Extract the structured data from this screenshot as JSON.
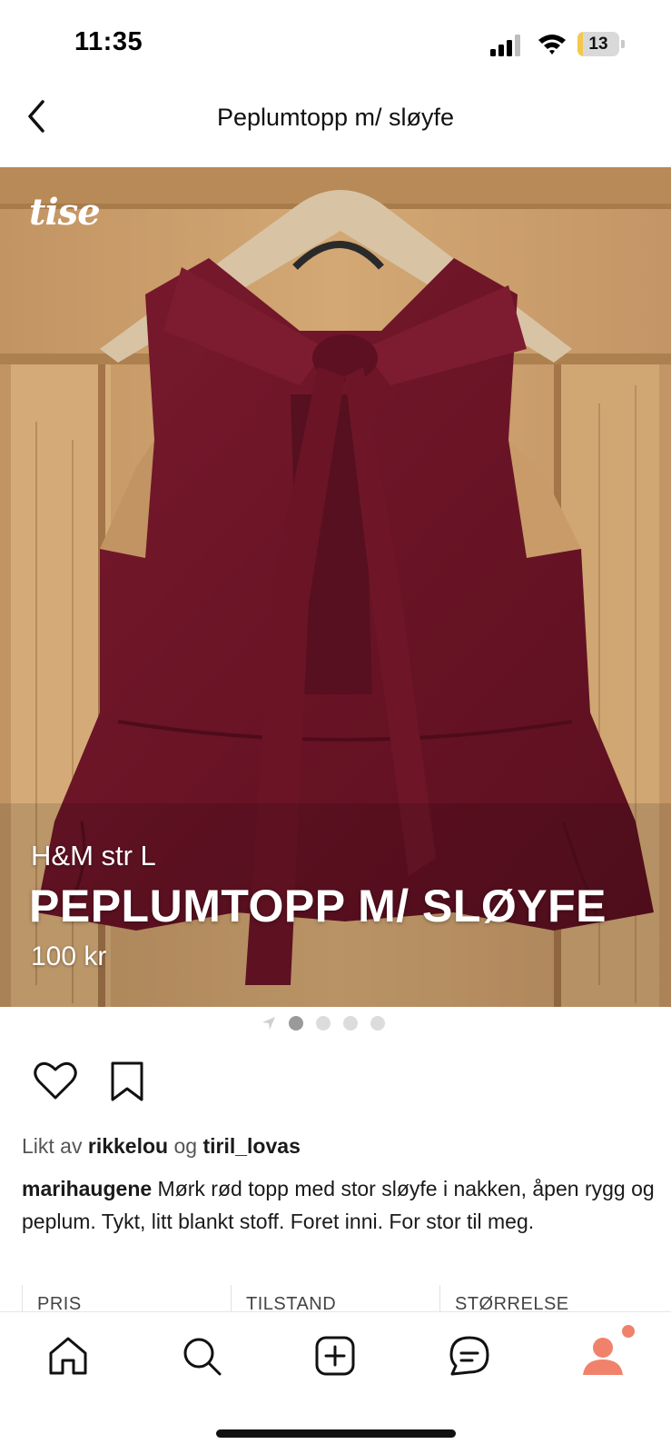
{
  "status_bar": {
    "time": "11:35",
    "battery_level": "13",
    "battery_fraction": 0.13,
    "icons": [
      "signal-icon",
      "wifi-icon",
      "battery-icon"
    ]
  },
  "header": {
    "title": "Peplumtopp m/ sløyfe",
    "back_icon": "chevron-left-icon"
  },
  "listing": {
    "image_watermark": "tise",
    "brand_size": "H&M str L",
    "title": "PEPLUMTOPP M/ SLØYFE",
    "price": "100 kr",
    "image_count": 4,
    "active_image_index": 0
  },
  "actions": {
    "like_icon": "heart-icon",
    "save_icon": "bookmark-icon"
  },
  "liked_by": {
    "prefix": "Likt av",
    "user1": "rikkelou",
    "conjunction": "og",
    "user2": "tiril_lovas"
  },
  "description": {
    "username": "marihaugene",
    "text": "Mørk rød topp med stor sløyfe i nakken, åpen rygg og peplum. Tykt, litt blankt stoff. Foret inni. For stor til meg."
  },
  "info_table": {
    "columns": [
      "PRIS",
      "TILSTAND",
      "STØRRELSE"
    ]
  },
  "tab_bar": {
    "tabs": [
      "home-icon",
      "search-icon",
      "add-icon",
      "messages-icon",
      "profile-icon"
    ],
    "profile_has_notification": true,
    "accent_color": "#f0826b"
  },
  "colors": {
    "garment": "#6e1628",
    "wood": "#c99d68",
    "text_primary": "#1a1a1a"
  }
}
